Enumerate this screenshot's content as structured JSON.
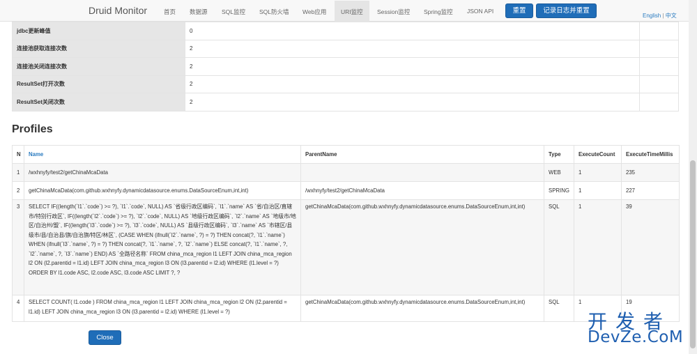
{
  "nav": {
    "brand": "Druid Monitor",
    "items": [
      {
        "label": "首页"
      },
      {
        "label": "数据源"
      },
      {
        "label": "SQL监控"
      },
      {
        "label": "SQL防火墙"
      },
      {
        "label": "Web应用"
      },
      {
        "label": "URI监控",
        "active": true
      },
      {
        "label": "Session监控"
      },
      {
        "label": "Spring监控"
      },
      {
        "label": "JSON API"
      }
    ],
    "reset_label": "重置",
    "reset_log_label": "记录日志并重置",
    "lang_en": "English",
    "lang_sep": "|",
    "lang_cn": "中文"
  },
  "summary": [
    {
      "key": "jdbc更新峰值",
      "value": "0"
    },
    {
      "key": "连接池获取连接次数",
      "value": "2"
    },
    {
      "key": "连接池关闭连接次数",
      "value": "2"
    },
    {
      "key": "ResultSet打开次数",
      "value": "2"
    },
    {
      "key": "ResultSet关闭次数",
      "value": "2"
    }
  ],
  "profiles": {
    "title": "Profiles",
    "columns": [
      "N",
      "Name",
      "ParentName",
      "Type",
      "ExecuteCount",
      "ExecuteTimeMillis"
    ],
    "rows": [
      {
        "n": "1",
        "name": "/wxhnyfy/test2/getChinaMcaData",
        "parent": "",
        "type": "WEB",
        "count": "1",
        "millis": "235"
      },
      {
        "n": "2",
        "name": "getChinaMcaData(com.github.wxhnyfy.dynamicdatasource.enums.DataSourceEnum,int,int)",
        "parent": "/wxhnyfy/test2/getChinaMcaData",
        "type": "SPRING",
        "count": "1",
        "millis": "227"
      },
      {
        "n": "3",
        "name": "SELECT IF((length(`l1`.`code`) >= ?), `l1`.`code`, NULL) AS `省级行政区编码`, `l1`.`name` AS `省/自治区/直辖市/特别行政区`, IF((length(`l2`.`code`) >= ?), `l2`.`code`, NULL) AS `地级行政区编码`, `l2`.`name` AS `地级市/地区/自治州/盟`, IF((length(`l3`.`code`) >= ?), `l3`.`code`, NULL) AS `县级行政区编码`, `l3`.`name` AS `市辖区/县级市/县/自治县/旗/自治旗/特区/林区`, (CASE WHEN (ifnull(`l2`.`name`, ?) = ?) THEN concat(?, `l1`.`name`) WHEN (ifnull(`l3`.`name`, ?) = ?) THEN concat(?, `l1`.`name`, ?, `l2`.`name`) ELSE concat(?, `l1`.`name`, ?, `l2`.`name`, ?, `l3`.`name`) END) AS `全路径名称` FROM china_mca_region l1 LEFT JOIN china_mca_region l2 ON (l2.parentid = l1.id) LEFT JOIN china_mca_region l3 ON (l3.parentid = l2.id) WHERE (l1.level = ?) ORDER BY l1.code ASC, l2.code ASC, l3.code ASC LIMIT ?, ?",
        "parent": "getChinaMcaData(com.github.wxhnyfy.dynamicdatasource.enums.DataSourceEnum,int,int)",
        "type": "SQL",
        "count": "1",
        "millis": "39"
      },
      {
        "n": "4",
        "name": "SELECT COUNT( l1.code ) FROM china_mca_region l1 LEFT JOIN china_mca_region l2 ON (l2.parentid = l1.id) LEFT JOIN china_mca_region l3 ON (l3.parentid = l2.id) WHERE (l1.level = ?)",
        "parent": "getChinaMcaData(com.github.wxhnyfy.dynamicdatasource.enums.DataSourceEnum,int,int)",
        "type": "SQL",
        "count": "1",
        "millis": "19"
      }
    ]
  },
  "close_label": "Close",
  "watermark": {
    "cn": "开发者",
    "en": "DevZe.CoM"
  }
}
